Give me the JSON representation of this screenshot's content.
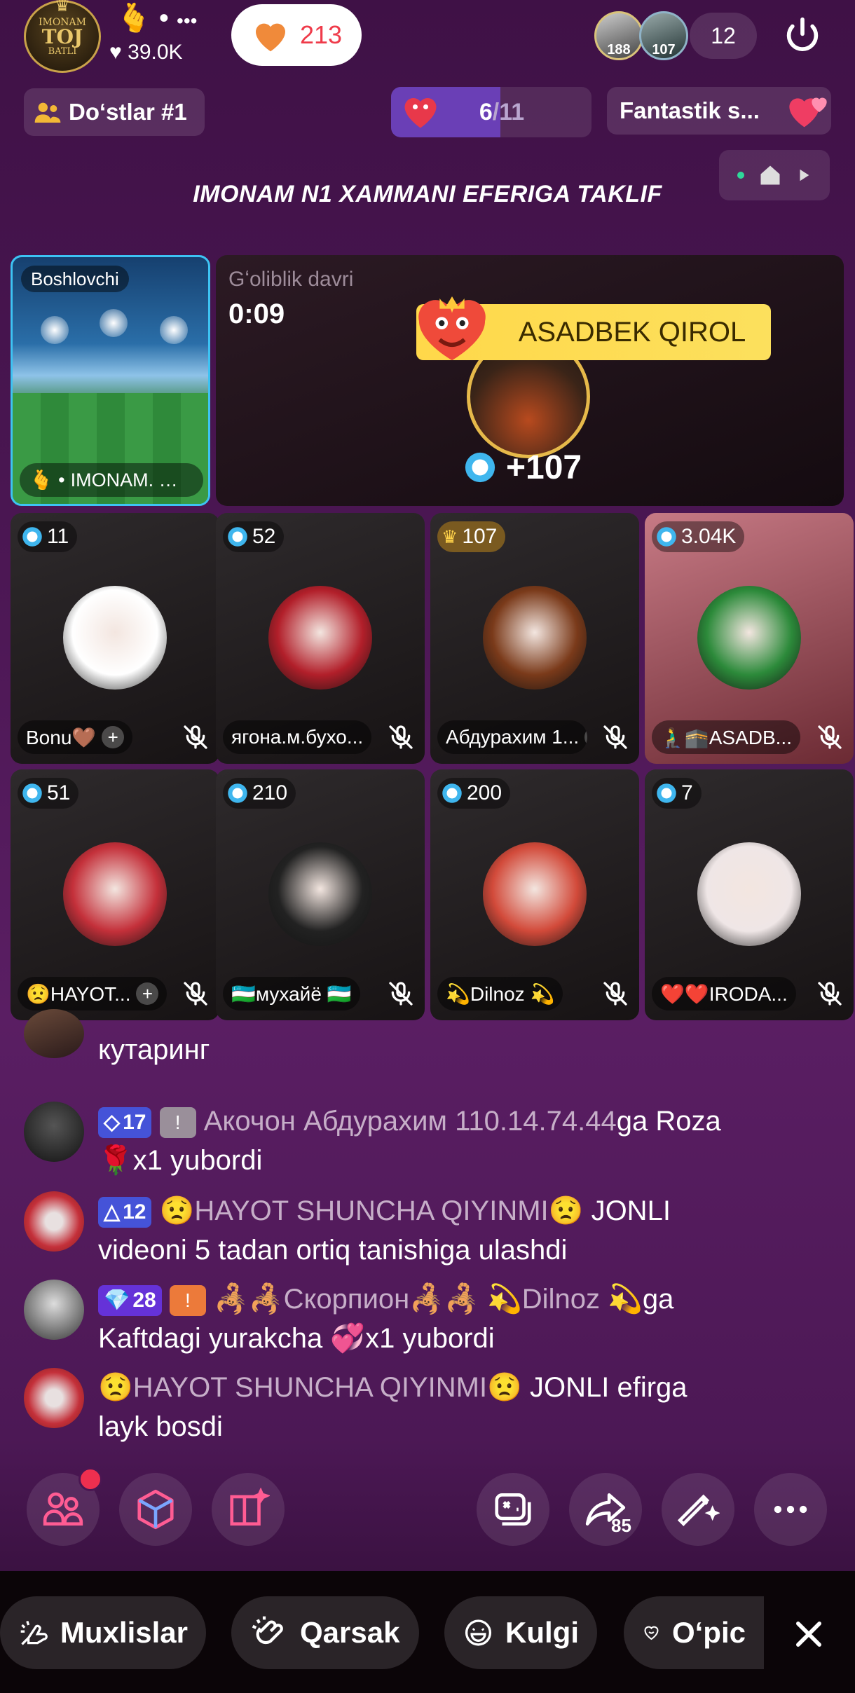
{
  "host": {
    "avatar_text": [
      "IMONAM",
      "TOJ",
      "BATLI"
    ],
    "name_prefix": "🫰 •",
    "more": "•••",
    "likes": "39.0K",
    "like_button_count": "213"
  },
  "viewers": {
    "badge1": "188",
    "badge2": "107",
    "count": "12"
  },
  "friends_label": "Doʻstlar #1",
  "progress": {
    "current": "6",
    "total": "/11",
    "fraction": 0.545
  },
  "fantastik_label": "Fantastik s...",
  "banner_title": "IMONAM N1 XAMMANI EFERIGA TAKLIF",
  "host_tile": {
    "tag": "Boshlovchi",
    "name": "IMONAM. …",
    "name_icon": "🫰 •"
  },
  "winner": {
    "label": "Gʻoliblik davri",
    "timer": "0:09",
    "name": "ASADBEK QIROL",
    "score": "+107"
  },
  "seats": [
    {
      "count": "11",
      "name": "Bonu🤎",
      "plus": true,
      "color": "#fff"
    },
    {
      "count": "52",
      "name": "ягона.м.бухо...",
      "plus": false,
      "color": "#b21f2a"
    },
    {
      "count": "107",
      "name": "Абдурахим 1...",
      "plus": true,
      "color": "#7a3a1a",
      "gold": true
    },
    {
      "count": "3.04K",
      "name": "🧎‍♂️🕋ASADB...",
      "plus": false,
      "color": "#2c8a3a"
    },
    {
      "count": "51",
      "name": "😟HAYOT...",
      "plus": true,
      "color": "#c4303a"
    },
    {
      "count": "210",
      "name": "🇺🇿мухайё 🇺🇿",
      "plus": false,
      "color": "#222"
    },
    {
      "count": "200",
      "name": "💫Dilnoz 💫",
      "plus": false,
      "color": "#d24a3a"
    },
    {
      "count": "7",
      "name": "❤️❤️IRODA...",
      "plus": false,
      "color": "#efe6e6"
    }
  ],
  "chat": {
    "partial_text": "кутаринг",
    "messages": [
      {
        "level": "17",
        "chip": "!",
        "user": "Акочон Абдурахим 110.14.74.44",
        "text1": "ga Roza",
        "text2": "🌹x1 yubordi"
      },
      {
        "level": "12",
        "user": "😟HAYOT SHUNCHA QIYINMI😟",
        "text1": " JONLI",
        "text2": "videoni 5 tadan ortiq tanishiga ulashdi"
      },
      {
        "level": "28",
        "chip": "!",
        "user": "🦂🦂Скорпион🦂🦂 💫Dilnoz 💫",
        "text1": "ga",
        "text2": "Kaftdagi yurakcha 💞x1 yubordi"
      },
      {
        "user": "😟HAYOT SHUNCHA QIYINMI😟",
        "text1": " JONLI efirga",
        "text2": "layk bosdi"
      }
    ]
  },
  "toolbar": {
    "share_count": "85"
  },
  "bottom_chips": {
    "muxlislar": "Muxlislar",
    "qarsak": "Qarsak",
    "kulgi": "Kulgi",
    "opic": "Oʻpic"
  },
  "colors": {
    "accent_red": "#ee2f4f",
    "bg": "#4a1652",
    "gold": "#e6b94a"
  }
}
